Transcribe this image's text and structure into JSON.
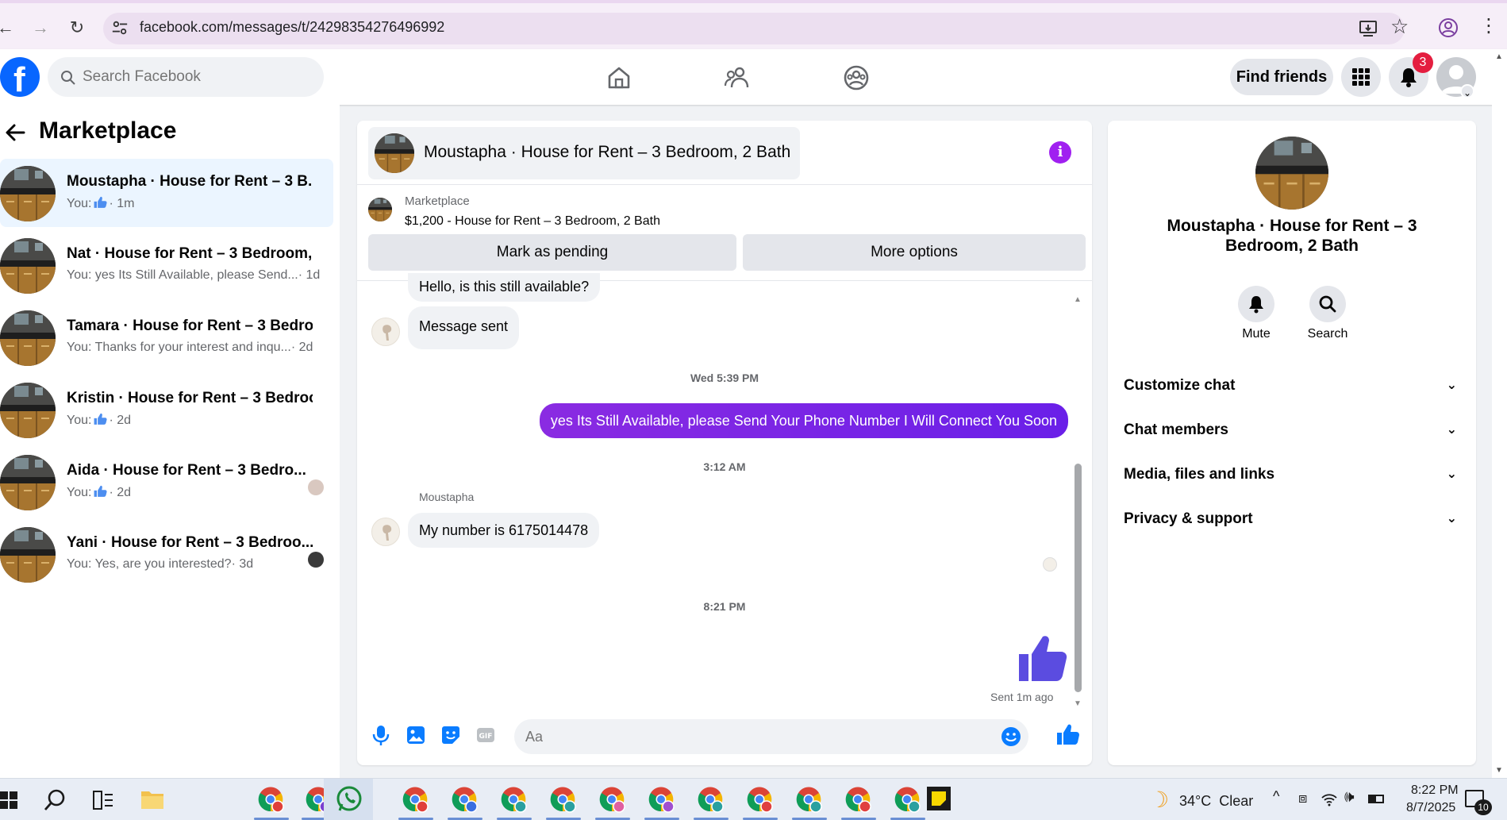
{
  "browser": {
    "url": "facebook.com/messages/t/24298354276496992"
  },
  "header": {
    "search_placeholder": "Search Facebook",
    "find_friends": "Find friends",
    "notification_count": "3"
  },
  "left": {
    "title": "Marketplace",
    "conversations": [
      {
        "name": "Moustapha · House for Rent – 3 B...",
        "prefix": "You:",
        "snippet": "",
        "time": "· 1m",
        "like": true
      },
      {
        "name": "Nat · House for Rent – 3 Bedroom,...",
        "prefix": "You: yes Its Still Available, please Send...",
        "snippet": "",
        "time": "· 1d",
        "like": false
      },
      {
        "name": "Tamara · House for Rent – 3 Bedro...",
        "prefix": "You: Thanks for your interest and inqu...",
        "snippet": "",
        "time": "· 2d",
        "like": false
      },
      {
        "name": "Kristin · House for Rent – 3 Bedroo...",
        "prefix": "You:",
        "snippet": "",
        "time": "· 2d",
        "like": true
      },
      {
        "name": "Aida · House for Rent – 3 Bedro...",
        "prefix": "You:",
        "snippet": "",
        "time": "· 2d",
        "like": true
      },
      {
        "name": "Yani · House for Rent – 3 Bedroo...",
        "prefix": "You: Yes, are you interested?",
        "snippet": "",
        "time": "· 3d",
        "like": false
      }
    ]
  },
  "chat": {
    "title": "Moustapha · House for Rent – 3 Bedroom, 2 Bath",
    "marketplace_label": "Marketplace",
    "listing": "$1,200 - House for Rent – 3 Bedroom, 2 Bath",
    "mark_pending": "Mark as pending",
    "more_options": "More options",
    "msg_1": "Hello, is this still available?",
    "msg_2": "Message sent",
    "time_1": "Wed 5:39 PM",
    "msg_3": "yes Its Still Available, please Send Your Phone Number I Will Connect You Soon",
    "time_2": "3:12 AM",
    "sender": "Moustapha",
    "msg_4": "My number is 6175014478",
    "time_3": "8:21 PM",
    "sent_note": "Sent 1m ago",
    "composer_placeholder": "Aa"
  },
  "right": {
    "name": "Moustapha · House for Rent – 3 Bedroom, 2 Bath",
    "mute": "Mute",
    "search": "Search",
    "sections": [
      "Customize chat",
      "Chat members",
      "Media, files and links",
      "Privacy & support"
    ]
  },
  "taskbar": {
    "weather": "34°C  Clear",
    "time": "8:22 PM",
    "date": "8/7/2025",
    "notif_count": "10"
  },
  "colors": {
    "fb_blue": "#0866ff",
    "messenger_purple": "#7b1ff2",
    "like_blue": "#0a7cff"
  }
}
